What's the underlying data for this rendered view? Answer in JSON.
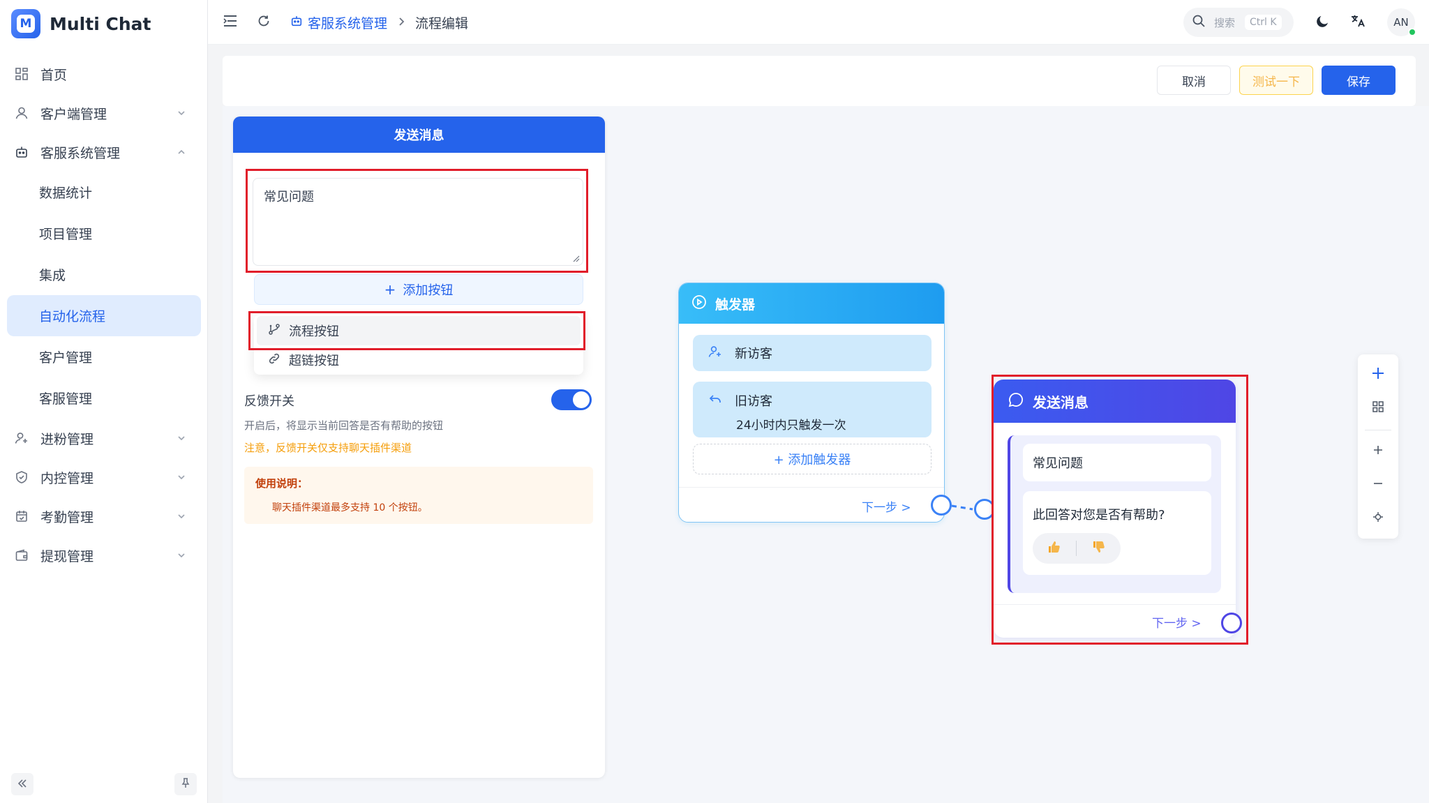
{
  "app": {
    "name": "Multi Chat",
    "logo_letter": "M"
  },
  "sidebar": {
    "items": [
      {
        "label": "首页",
        "icon": "grid-icon"
      },
      {
        "label": "客户端管理",
        "icon": "user-icon"
      },
      {
        "label": "客服系统管理",
        "icon": "robot-icon"
      },
      {
        "label": "数据统计"
      },
      {
        "label": "项目管理"
      },
      {
        "label": "集成"
      },
      {
        "label": "自动化流程"
      },
      {
        "label": "客户管理"
      },
      {
        "label": "客服管理"
      },
      {
        "label": "进粉管理",
        "icon": "user-plus-icon"
      },
      {
        "label": "内控管理",
        "icon": "shield-icon"
      },
      {
        "label": "考勤管理",
        "icon": "calendar-check-icon"
      },
      {
        "label": "提现管理",
        "icon": "wallet-icon"
      }
    ]
  },
  "header": {
    "breadcrumb": {
      "parent": "客服系统管理",
      "current": "流程编辑"
    },
    "search": {
      "placeholder": "搜索",
      "shortcut": "Ctrl K"
    },
    "avatar": "AN"
  },
  "toolbar": {
    "cancel": "取消",
    "test": "测试一下",
    "save": "保存"
  },
  "config_panel": {
    "title": "发送消息",
    "message_text": "常见问题",
    "add_button": "添加按钮",
    "menu": [
      "流程按钮",
      "超链按钮"
    ],
    "feedback_label": "反馈开关",
    "feedback_desc": "开启后，将显示当前回答是否有帮助的按钮",
    "feedback_warning": "注意，反馈开关仅支持聊天插件渠道",
    "notice_title": "使用说明：",
    "notice_text": "聊天插件渠道最多支持 10 个按钮。"
  },
  "trigger_node": {
    "title": "触发器",
    "items": [
      {
        "label": "新访客"
      },
      {
        "label": "旧访客",
        "sub": "24小时内只触发一次"
      }
    ],
    "add": "+ 添加触发器",
    "next": "下一步 >"
  },
  "send_node": {
    "title": "发送消息",
    "message": "常见问题",
    "feedback_question": "此回答对您是否有帮助?",
    "next": "下一步 >"
  },
  "colors": {
    "primary": "#2563eb",
    "highlight": "#e11d2a",
    "trigger": "#1e9cf0",
    "send": "#4f46e5"
  }
}
